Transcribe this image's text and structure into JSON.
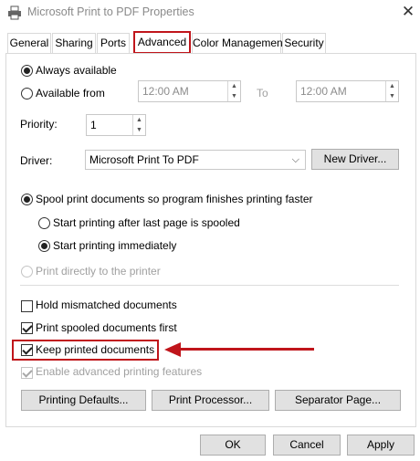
{
  "window": {
    "title": "Microsoft Print to PDF Properties"
  },
  "tabs": [
    {
      "label": "General"
    },
    {
      "label": "Sharing"
    },
    {
      "label": "Ports"
    },
    {
      "label": "Advanced"
    },
    {
      "label": "Color Management"
    },
    {
      "label": "Security"
    }
  ],
  "availability": {
    "always_label": "Always available",
    "from_label": "Available from",
    "from_time": "12:00 AM",
    "to_label": "To",
    "to_time": "12:00 AM"
  },
  "priority": {
    "label": "Priority:",
    "value": "1"
  },
  "driver": {
    "label": "Driver:",
    "selected": "Microsoft Print To PDF",
    "new_driver_button": "New Driver..."
  },
  "spooling": {
    "spool_label": "Spool print documents so program finishes printing faster",
    "after_last_page": "Start printing after last page is spooled",
    "immediately": "Start printing immediately",
    "direct": "Print directly to the printer"
  },
  "options": {
    "hold_mismatched": "Hold mismatched documents",
    "spooled_first": "Print spooled documents first",
    "keep_printed": "Keep printed documents",
    "advanced_features": "Enable advanced printing features"
  },
  "buttons": {
    "printing_defaults": "Printing Defaults...",
    "print_processor": "Print Processor...",
    "separator_page": "Separator Page...",
    "ok": "OK",
    "cancel": "Cancel",
    "apply": "Apply"
  },
  "colors": {
    "highlight": "#c0151b"
  }
}
